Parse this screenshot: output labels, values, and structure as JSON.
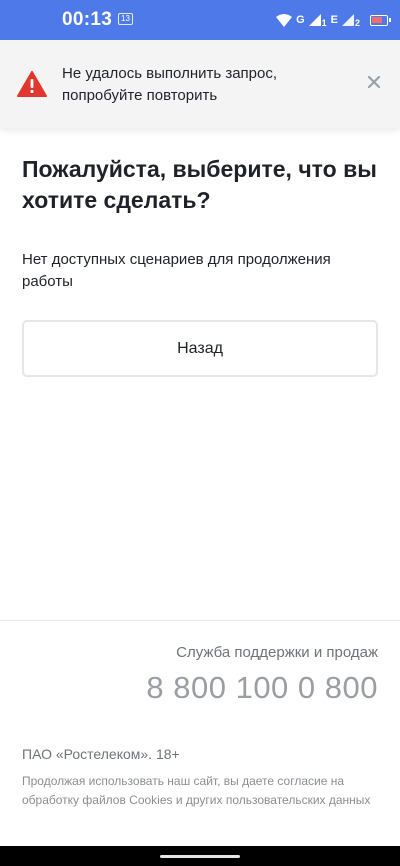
{
  "status_bar": {
    "time": "00:13",
    "notification_badge": "13",
    "network_1": "G",
    "sim_1": "1",
    "network_2": "E",
    "sim_2": "2",
    "background_color": "#4e79e8"
  },
  "alert": {
    "icon": "warning-triangle-icon",
    "message": "Не удалось выполнить запрос, попробуйте повторить",
    "close_icon": "close-icon",
    "accent_color": "#e2372f"
  },
  "main": {
    "title": "Пожалуйста, выберите, что вы хотите сделать?",
    "description": "Нет доступных сценариев для продолжения работы",
    "back_button_label": "Назад"
  },
  "footer": {
    "support_label": "Служба поддержки и продаж",
    "support_phone": "8 800 100 0 800",
    "company": "ПАО «Ростелеком». 18+",
    "cookie_note": "Продолжая использовать наш сайт, вы даете согласие на обработку файлов Cookies и других пользовательских данных"
  }
}
